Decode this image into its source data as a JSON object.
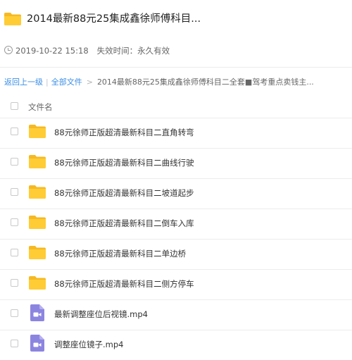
{
  "header": {
    "title": "2014最新88元25集成鑫徐师傅科目...",
    "date": "2019-10-22 15:18",
    "expiry": "失效时间：永久有效"
  },
  "breadcrumb": {
    "back": "返回上一级",
    "separator": "|",
    "all_files": "全部文件",
    "arrow": ">",
    "current": "2014最新88元25集成鑫徐师傅科目二全套■驾考重点卖钱主..."
  },
  "list": {
    "header": "文件名",
    "items": [
      {
        "name": "88元徐师正版超清最新科目二直角转弯",
        "icon": "folder-icon"
      },
      {
        "name": "88元徐师正版超清最新科目二曲线行驶",
        "icon": "folder-icon"
      },
      {
        "name": "88元徐师正版超清最新科目二坡道起步",
        "icon": "folder-icon"
      },
      {
        "name": "88元徐师正版超清最新科目二倒车入库",
        "icon": "folder-icon"
      },
      {
        "name": "88元徐师正版超清最新科目二单边桥",
        "icon": "folder-icon"
      },
      {
        "name": "88元徐师正版超清最新科目二侧方停车",
        "icon": "folder-icon"
      },
      {
        "name": "最新调整座位后视镜.mp4",
        "icon": "video-file-icon"
      },
      {
        "name": "调整座位镜子.mp4",
        "icon": "video-file-icon"
      }
    ]
  },
  "colors": {
    "folder": "#FFCC35",
    "folder_tab": "#F6B921",
    "video": "#8C85E0",
    "link": "#3A8EE6"
  }
}
